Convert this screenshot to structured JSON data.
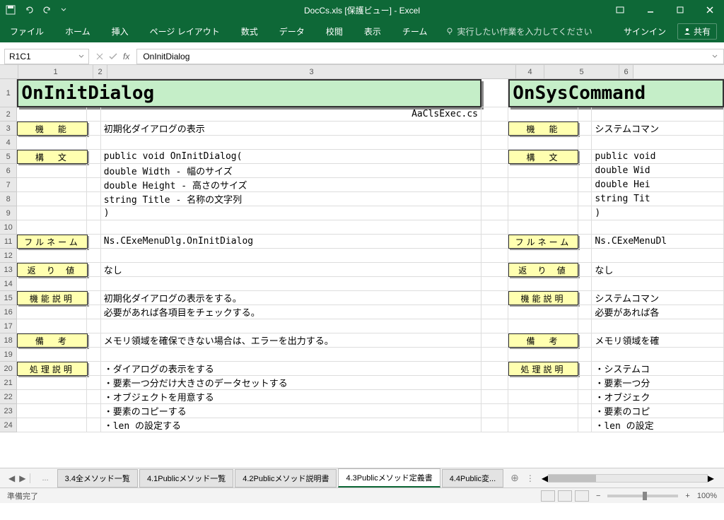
{
  "titlebar": {
    "title": "DocCs.xls [保護ビュー] - Excel"
  },
  "ribbon": {
    "tabs": [
      "ファイル",
      "ホーム",
      "挿入",
      "ページ レイアウト",
      "数式",
      "データ",
      "校閲",
      "表示",
      "チーム"
    ],
    "tell_placeholder": "実行したい作業を入力してください",
    "signin": "サインイン",
    "share": "共有"
  },
  "formulabar": {
    "namebox": "R1C1",
    "formula": "OnInitDialog"
  },
  "columns": [
    "1",
    "2",
    "3",
    "4",
    "5",
    "6"
  ],
  "sheet": {
    "title_left": "OnInitDialog",
    "title_right": "OnSysCommand",
    "filename": "AaClsExec.cs",
    "rows": [
      {
        "n": "3",
        "label_l": "機　能",
        "text_l": "初期化ダイアログの表示",
        "label_r": "機　能",
        "text_r": "システムコマン"
      },
      {
        "n": "4",
        "text_l": ""
      },
      {
        "n": "5",
        "label_l": "構　文",
        "text_l": "public void OnInitDialog(",
        "label_r": "構　文",
        "text_r": "public void"
      },
      {
        "n": "6",
        "text_l": "  double Width   - 幅のサイズ",
        "text_r": "  double Wid"
      },
      {
        "n": "7",
        "text_l": "  double Height  - 高さのサイズ",
        "text_r": "  double Hei"
      },
      {
        "n": "8",
        "text_l": "  string Title   - 名称の文字列",
        "text_r": "  string Tit"
      },
      {
        "n": "9",
        "text_l": ")",
        "text_r": ")"
      },
      {
        "n": "10",
        "text_l": ""
      },
      {
        "n": "11",
        "label_l": "フルネーム",
        "text_l": "Ns.CExeMenuDlg.OnInitDialog",
        "label_r": "フルネーム",
        "text_r": "Ns.CExeMenuDl"
      },
      {
        "n": "12",
        "text_l": ""
      },
      {
        "n": "13",
        "label_l": "返 り 値",
        "text_l": "なし",
        "label_r": "返 り 値",
        "text_r": "なし"
      },
      {
        "n": "14",
        "text_l": ""
      },
      {
        "n": "15",
        "label_l": "機能説明",
        "text_l": "初期化ダイアログの表示をする。",
        "label_r": "機能説明",
        "text_r": "システムコマン"
      },
      {
        "n": "16",
        "text_l": "必要があれば各項目をチェックする。",
        "text_r": "必要があれば各"
      },
      {
        "n": "17",
        "text_l": ""
      },
      {
        "n": "18",
        "label_l": "備　考",
        "text_l": "メモリ領域を確保できない場合は、エラーを出力する。",
        "label_r": "備　考",
        "text_r": "メモリ領域を確"
      },
      {
        "n": "19",
        "text_l": ""
      },
      {
        "n": "20",
        "label_l": "処理説明",
        "text_l": "・ダイアログの表示をする",
        "label_r": "処理説明",
        "text_r": "・システムコ"
      },
      {
        "n": "21",
        "text_l": "・要素一つ分だけ大きさのデータセットする",
        "text_r": "・要素一つ分"
      },
      {
        "n": "22",
        "text_l": "・オブジェクトを用意する",
        "text_r": "・オブジェク"
      },
      {
        "n": "23",
        "text_l": "・要素のコピーする",
        "text_r": "・要素のコピ"
      },
      {
        "n": "24",
        "text_l": "・len の設定する",
        "text_r": "・len の設定"
      }
    ]
  },
  "sheettabs": {
    "more": "...",
    "tabs": [
      "3.4全メソッド一覧",
      "4.1Publicメソッド一覧",
      "4.2Publicメソッド説明書",
      "4.3Publicメソッド定義書",
      "4.4Public変..."
    ],
    "active": 3
  },
  "statusbar": {
    "status": "準備完了",
    "zoom": "100%"
  }
}
